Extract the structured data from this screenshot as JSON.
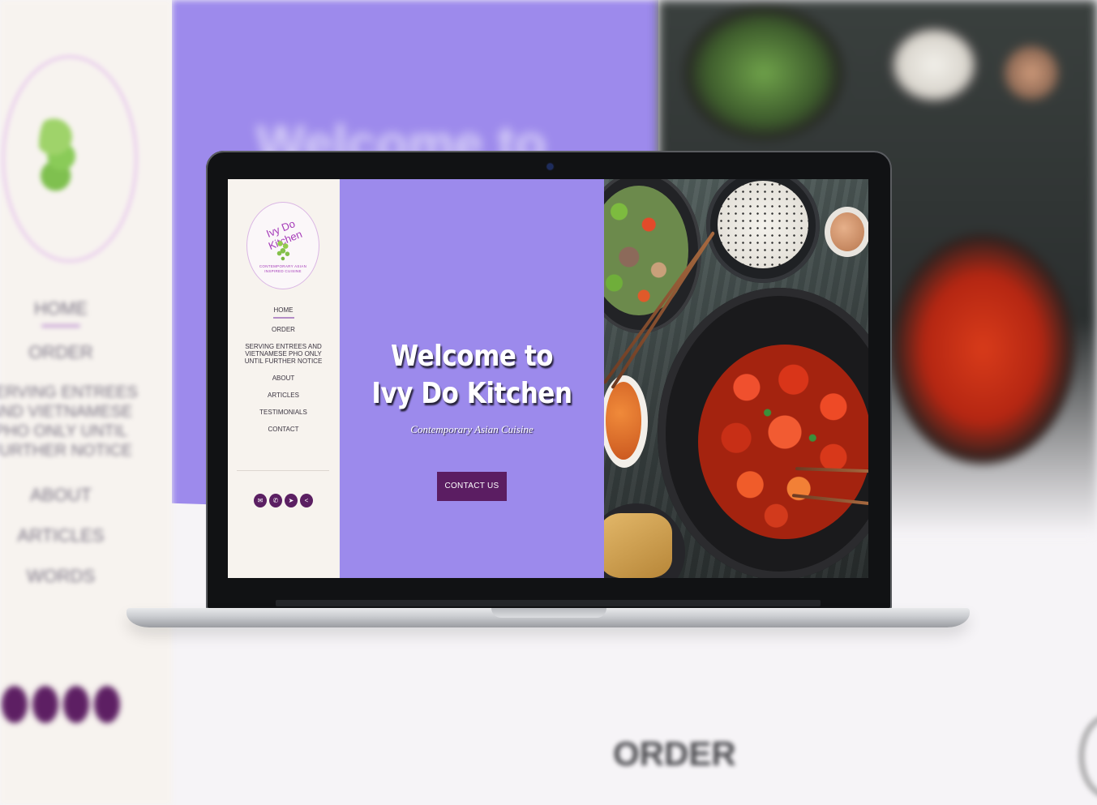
{
  "background": {
    "nav_items": [
      "HOME",
      "ORDER",
      "SERVING ENTREES AND VIETNAMESE PHO ONLY UNTIL FURTHER NOTICE",
      "ABOUT",
      "ARTICLES",
      "WORDS"
    ],
    "welcome_fragment": "Welcome to",
    "order_heading": "ORDER"
  },
  "logo": {
    "name": "Ivy Do Kitchen",
    "tagline": "CONTEMPORARY ASIAN INSPIRED CUISINE"
  },
  "nav": {
    "items": [
      {
        "label": "HOME",
        "active": true
      },
      {
        "label": "ORDER"
      },
      {
        "label": "SERVING ENTREES AND VIETNAMESE PHO ONLY UNTIL FURTHER NOTICE"
      },
      {
        "label": "ABOUT"
      },
      {
        "label": "ARTICLES"
      },
      {
        "label": "TESTIMONIALS"
      },
      {
        "label": "CONTACT"
      }
    ]
  },
  "social": {
    "icons": [
      "email-icon",
      "phone-icon",
      "location-icon",
      "share-icon"
    ],
    "glyphs": [
      "✉",
      "✆",
      "➤",
      "<"
    ]
  },
  "hero": {
    "title_line1": "Welcome to",
    "title_line2": "Ivy Do Kitchen",
    "subtitle": "Contemporary Asian Cuisine",
    "cta_label": "CONTACT US"
  },
  "colors": {
    "hero_bg": "#9c8aec",
    "accent": "#5b1d62",
    "sidebar_bg": "#f7f3ee",
    "logo_text": "#a438b8",
    "logo_leaf": "#93cc4d"
  }
}
